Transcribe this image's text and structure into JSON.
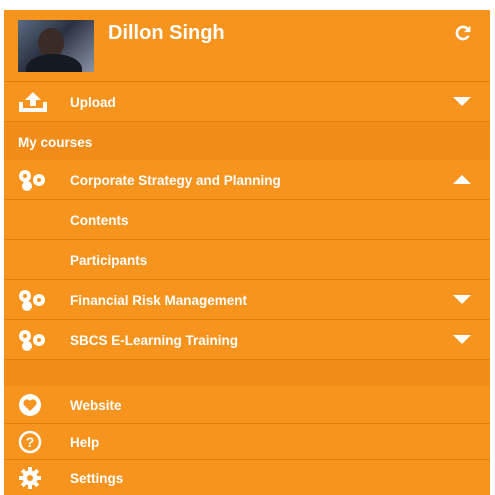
{
  "user": {
    "name": "Dillon Singh"
  },
  "upload": {
    "label": "Upload"
  },
  "my_courses": {
    "heading": "My courses"
  },
  "courses": [
    {
      "label": "Corporate Strategy and Planning",
      "expanded": true,
      "children": [
        {
          "label": "Contents"
        },
        {
          "label": "Participants"
        }
      ]
    },
    {
      "label": "Financial Risk Management",
      "expanded": false
    },
    {
      "label": "SBCS E-Learning Training",
      "expanded": false
    }
  ],
  "footer": [
    {
      "label": "Website",
      "icon": "heart-icon"
    },
    {
      "label": "Help",
      "icon": "help-icon"
    },
    {
      "label": "Settings",
      "icon": "gear-icon"
    }
  ],
  "colors": {
    "background": "#f7941d",
    "divider": "#e07f0c",
    "text": "#ffffff"
  }
}
